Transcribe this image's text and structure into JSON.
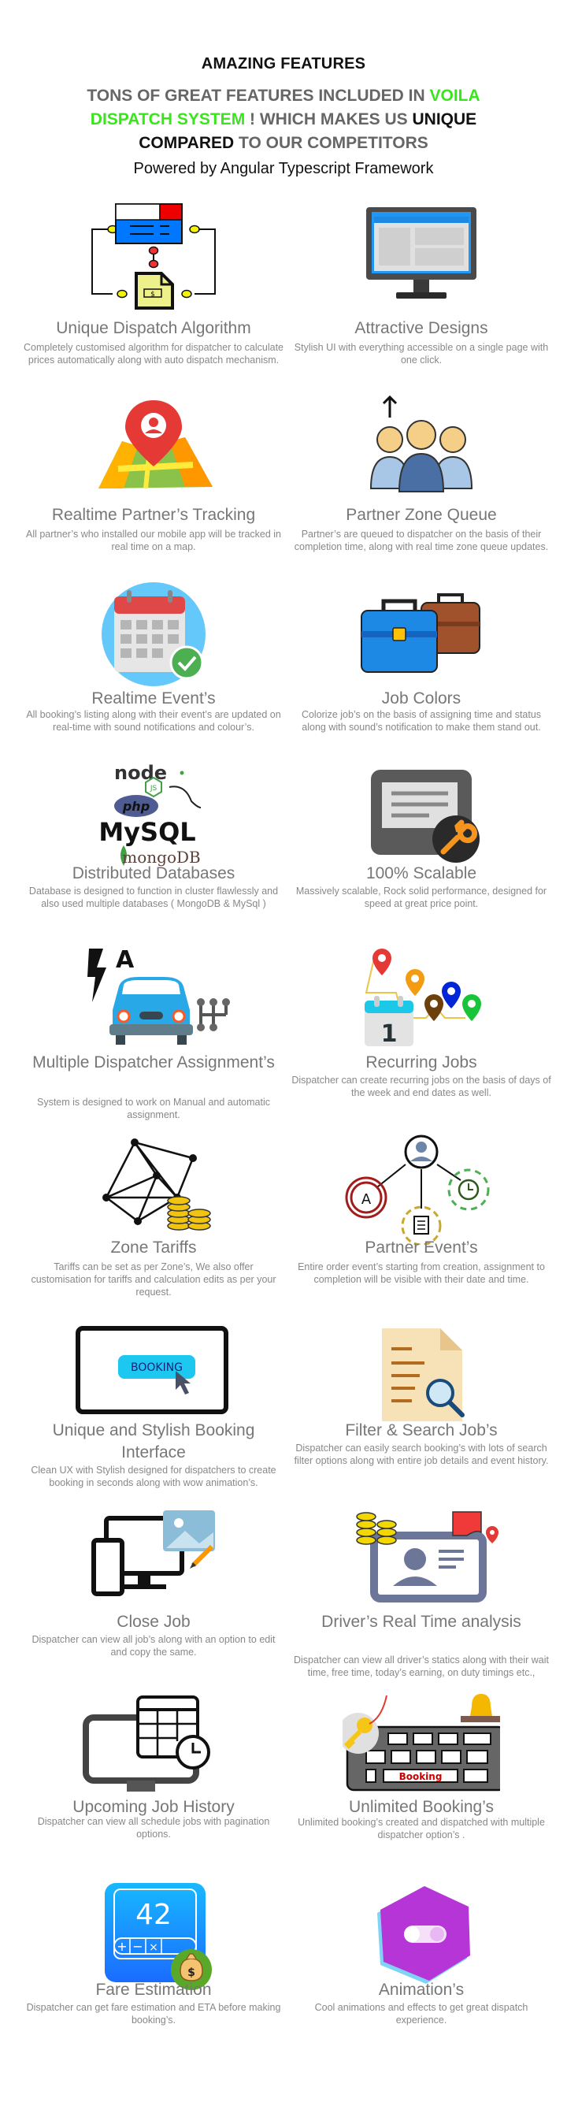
{
  "header": {
    "title": "AMAZING FEATURES",
    "subtitle_parts": [
      {
        "text": "TONS OF GREAT FEATURES INCLUDED IN ",
        "style": "gray"
      },
      {
        "text": "VOILA DISPATCH SYSTEM",
        "style": "green"
      },
      {
        "text": " ! WHICH MAKES US ",
        "style": "gray"
      },
      {
        "text": "UNIQUE COMPARED",
        "style": "dark"
      },
      {
        "text": " TO OUR COMPETITORS",
        "style": "gray"
      }
    ],
    "powered_by": "Powered by  Angular Typescript Framework"
  },
  "colors": {
    "accent_green": "#39e61c",
    "title_gray": "#777777",
    "desc_gray": "#888888",
    "heading_dark": "#111111"
  },
  "features": [
    {
      "title": "Unique Dispatch Algorithm",
      "description": "Completely customised  algorithm for dispatcher to calculate prices automatically along with auto dispatch mechanism.",
      "icon": "dispatch-algorithm-icon"
    },
    {
      "title": "Attractive Designs",
      "description": "Stylish UI with everything accessible on a single page with one click.",
      "icon": "monitor-icon"
    },
    {
      "title": "Realtime Partner’s Tracking",
      "description": "All partner’s who installed our mobile app will be tracked in real time on a map.",
      "icon": "map-pin-icon"
    },
    {
      "title": "Partner  Zone Queue",
      "description": "Partner’s are queued to dispatcher on the basis of their completion time, along with real time zone queue updates.",
      "icon": "queue-users-icon"
    },
    {
      "title": "Realtime Event’s",
      "description": "All booking’s listing along with their event’s are updated on real-time with sound notifications and colour’s.",
      "icon": "calendar-check-icon"
    },
    {
      "title": "Job Colors",
      "description": "Colorize job’s on the basis of assigning time and status along with sound’s notification to make them stand out.",
      "icon": "briefcases-icon"
    },
    {
      "title": "Distributed Databases",
      "description": "Database is designed to function in cluster flawlessly and also used  multiple databases ( MongoDB & MySql )",
      "icon": "database-logos-icon",
      "logos": {
        "node": "node",
        "js": "JS",
        "php": "php",
        "mysql": "MySQL",
        "mongo": "mongoDB"
      }
    },
    {
      "title": "100% Scalable",
      "description": "Massively scalable, Rock solid performance, designed for speed at great price point.",
      "icon": "settings-wrench-icon"
    },
    {
      "title": "Multiple Dispatcher Assignment’s",
      "description": "System is designed to work on Manual and automatic assignment.",
      "icon": "car-auto-manual-icon",
      "badge": "A"
    },
    {
      "title": "Recurring Jobs",
      "description": "Dispatcher can create recurring jobs on the basis of days of the week and end dates as well.",
      "icon": "recurring-calendar-pins-icon",
      "calendar_day": "1"
    },
    {
      "title": "Zone Tariffs",
      "description": "Tariffs can be set as per Zone’s, We also offer customisation for tariffs and calculation edits as per your request.",
      "icon": "network-coins-icon"
    },
    {
      "title": "Partner Event’s",
      "description": "Entire order event’s starting from creation, assignment to completion will be visible with their date and time.",
      "icon": "partner-events-icon",
      "badge": "A"
    },
    {
      "title": "Unique and Stylish Booking Interface",
      "description": "Clean UX with Stylish designed  for dispatchers to create booking in seconds along with wow animation’s.",
      "icon": "booking-button-icon",
      "button_label": "BOOKING"
    },
    {
      "title": "Filter & Search Job’s",
      "description": "Dispatcher can easily search booking’s with  lots of search filter options along with entire job details and event history.",
      "icon": "document-search-icon"
    },
    {
      "title": "Close Job",
      "description": "Dispatcher can view all job’s along with an option to edit and copy the same.",
      "icon": "devices-edit-icon"
    },
    {
      "title": "Driver’s Real Time analysis",
      "description": "Dispatcher can view all driver’s statics along with their wait time, free time, today’s earning, on duty timings etc.,",
      "icon": "driver-card-icon"
    },
    {
      "title": "Upcoming Job History",
      "description": "Dispatcher can view all schedule jobs with pagination options.",
      "icon": "schedule-monitor-icon"
    },
    {
      "title": "Unlimited Booking’s",
      "description": "Unlimited booking’s created and dispatched with multiple dispatcher option’s .",
      "icon": "keyboard-bell-icon",
      "key_label": "Booking"
    },
    {
      "title": "Fare Estimation",
      "description": "Dispatcher can get fare estimation and ETA before making booking’s.",
      "icon": "calculator-money-icon",
      "display_value": "42"
    },
    {
      "title": "Animation’s",
      "description": "Cool animations and effects to get great dispatch experience.",
      "icon": "toggle-hexagon-icon"
    }
  ]
}
